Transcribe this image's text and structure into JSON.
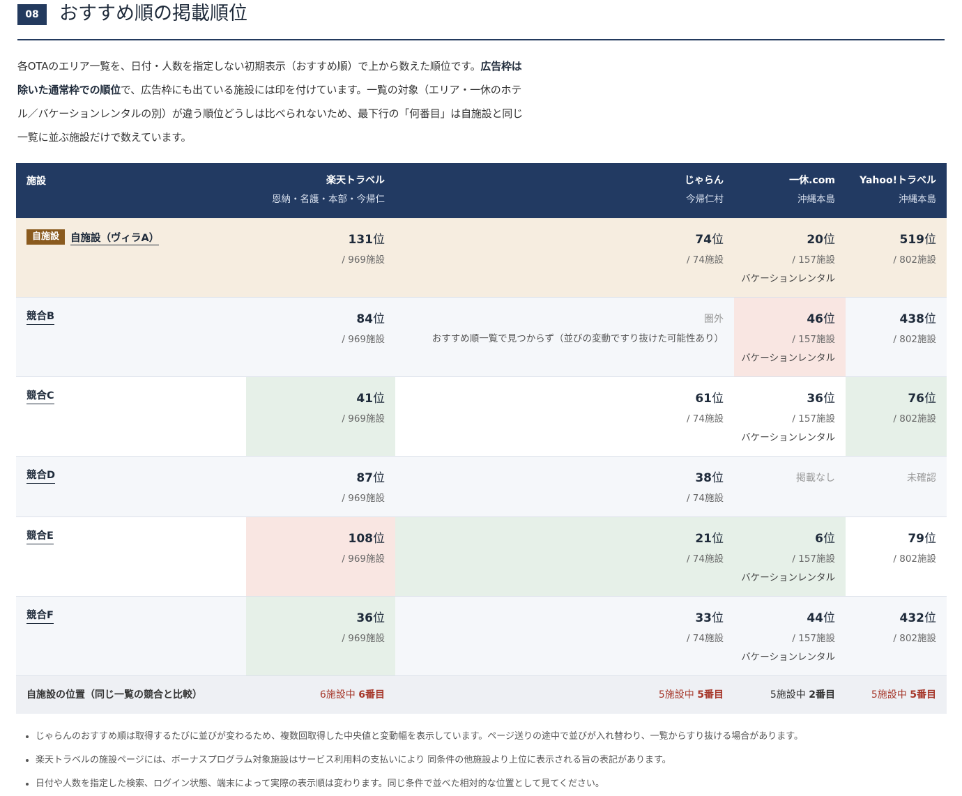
{
  "section": {
    "number": "08",
    "title": "おすすめ順の掲載順位"
  },
  "intro": {
    "p1": "各OTAのエリア一覧を、日付・人数を指定しない初期表示（おすすめ順）で上から数えた順位です。",
    "bold1": "広告枠は除いた通常枠での順位",
    "p2": "で、広告枠にも出ている施設には印を付けています。一覧の対象（エリア・一休のホテル／バケーションレンタルの別）が違う順位どうしは比べられないため、最下行の「何番目」は自施設と同じ一覧に並ぶ施設だけで数えています。"
  },
  "table": {
    "header": {
      "facility": "施設",
      "otas": [
        {
          "name": "楽天トラベル",
          "area": "恩納・名護・本部・今帰仁"
        },
        {
          "name": "じゃらん",
          "area": "今帰仁村"
        },
        {
          "name": "一休.com",
          "area": "沖縄本島"
        },
        {
          "name": "Yahoo!トラベル",
          "area": "沖縄本島"
        }
      ]
    },
    "own": {
      "tag": "自施設",
      "name": "自施設（ヴィラA）",
      "rak": {
        "rank": "131",
        "suffix": "位",
        "total": "/ 969施設"
      },
      "jal": {
        "rank": "74",
        "suffix": "位",
        "total": "/ 74施設"
      },
      "ikk": {
        "rank": "20",
        "suffix": "位",
        "total": "/ 157施設",
        "type": "バケーションレンタル"
      },
      "yah": {
        "rank": "519",
        "suffix": "位",
        "total": "/ 802施設"
      }
    },
    "b": {
      "name": "競合B",
      "rak": {
        "rank": "84",
        "suffix": "位",
        "total": "/ 969施設"
      },
      "jal": {
        "status": "圏外",
        "note": "おすすめ順一覧で見つからず（並びの変動ですり抜けた可能性あり）"
      },
      "ikk": {
        "rank": "46",
        "suffix": "位",
        "total": "/ 157施設",
        "type": "バケーションレンタル"
      },
      "yah": {
        "rank": "438",
        "suffix": "位",
        "total": "/ 802施設"
      }
    },
    "c": {
      "name": "競合C",
      "rak": {
        "rank": "41",
        "suffix": "位",
        "total": "/ 969施設"
      },
      "jal": {
        "rank": "61",
        "suffix": "位",
        "total": "/ 74施設"
      },
      "ikk": {
        "rank": "36",
        "suffix": "位",
        "total": "/ 157施設",
        "type": "バケーションレンタル"
      },
      "yah": {
        "rank": "76",
        "suffix": "位",
        "total": "/ 802施設"
      }
    },
    "d": {
      "name": "競合D",
      "rak": {
        "rank": "87",
        "suffix": "位",
        "total": "/ 969施設"
      },
      "jal": {
        "rank": "38",
        "suffix": "位",
        "total": "/ 74施設"
      },
      "ikk": {
        "status": "掲載なし"
      },
      "yah": {
        "status": "未確認"
      }
    },
    "e": {
      "name": "競合E",
      "rak": {
        "rank": "108",
        "suffix": "位",
        "total": "/ 969施設"
      },
      "jal": {
        "rank": "21",
        "suffix": "位",
        "total": "/ 74施設"
      },
      "ikk": {
        "rank": "6",
        "suffix": "位",
        "total": "/ 157施設",
        "type": "バケーションレンタル"
      },
      "yah": {
        "rank": "79",
        "suffix": "位",
        "total": "/ 802施設"
      }
    },
    "f": {
      "name": "競合F",
      "rak": {
        "rank": "36",
        "suffix": "位",
        "total": "/ 969施設"
      },
      "jal": {
        "rank": "33",
        "suffix": "位",
        "total": "/ 74施設"
      },
      "ikk": {
        "rank": "44",
        "suffix": "位",
        "total": "/ 157施設",
        "type": "バケーションレンタル"
      },
      "yah": {
        "rank": "432",
        "suffix": "位",
        "total": "/ 802施設"
      }
    },
    "summary": {
      "label": "自施設の位置（同じ一覧の競合と比較）",
      "rak": {
        "pre": "6施設中 ",
        "pos": "6番目"
      },
      "jal": {
        "pre": "5施設中 ",
        "pos": "5番目"
      },
      "ikk": {
        "pre": "5施設中 ",
        "pos": "2番目"
      },
      "yah": {
        "pre": "5施設中 ",
        "pos": "5番目"
      }
    }
  },
  "notes": [
    "じゃらんのおすすめ順は取得するたびに並びが変わるため、複数回取得した中央値と変動幅を表示しています。ページ送りの途中で並びが入れ替わり、一覧からすり抜ける場合があります。",
    "楽天トラベルの施設ページには、ボーナスプログラム対象施設はサービス利用料の支払いにより 同条件の他施設より上位に表示される旨の表記があります。",
    "日付や人数を指定した検索、ログイン状態、端末によって実際の表示順は変わります。同じ条件で並べた相対的な位置として見てください。"
  ],
  "colors": {
    "navy": "#223a62",
    "own_row": "#f6ede0",
    "better": "#e6f0e8",
    "worse": "#f9e6e2",
    "summary_red": "#a6372a"
  }
}
